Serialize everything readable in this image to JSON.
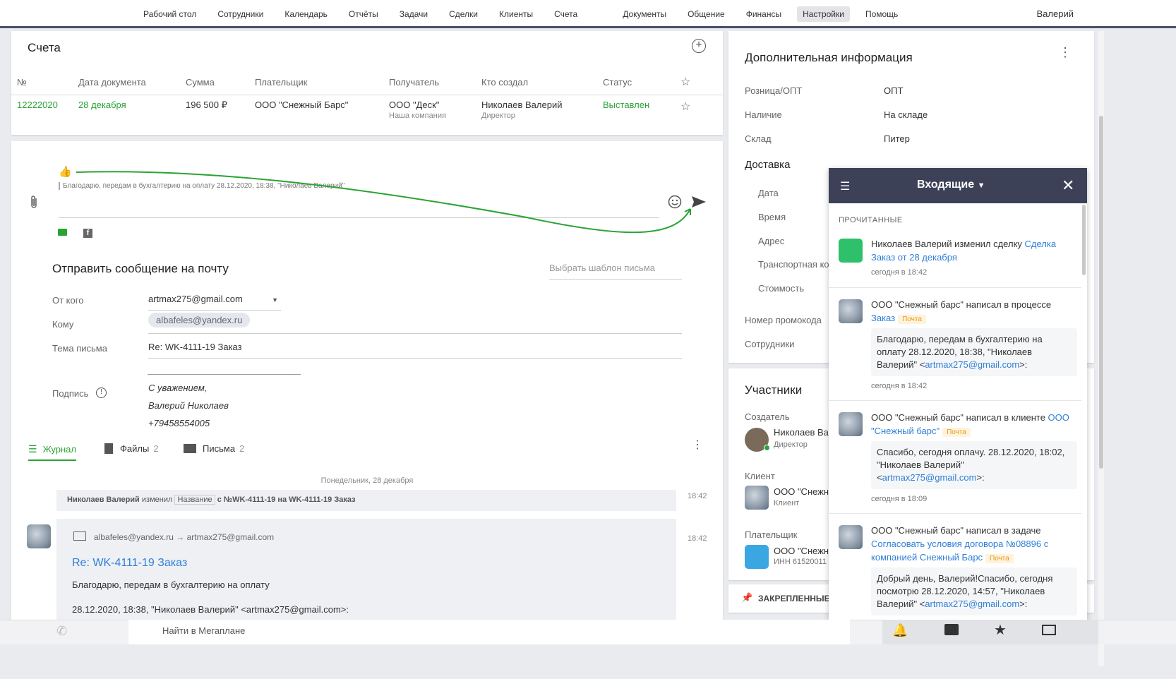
{
  "nav": {
    "items": [
      "Рабочий стол",
      "Сотрудники",
      "Календарь",
      "Отчёты",
      "Задачи",
      "Сделки",
      "Клиенты",
      "Счета",
      "Документы",
      "Общение",
      "Финансы",
      "Настройки",
      "Помощь"
    ],
    "active": "Настройки",
    "user": "Валерий"
  },
  "invoices": {
    "title": "Счета",
    "headers": [
      "№",
      "Дата документа",
      "Сумма",
      "Плательщик",
      "Получатель",
      "Кто создал",
      "Статус"
    ],
    "row": {
      "num": "12222020",
      "date": "28 декабря",
      "sum": "196 500 ₽",
      "payer": "ООО \"Снежный Барс\"",
      "recipient": "ООО \"Деск\"",
      "recipient_sub": "Наша компания",
      "creator": "Николаев Валерий",
      "creator_sub": "Директор",
      "status": "Выставлен"
    }
  },
  "composer": {
    "reply_quote": "Благодарю, передам в бухгалтерию на оплату  28.12.2020, 18:38, \"Николаев Валерий\"",
    "email_title": "Отправить сообщение на почту",
    "template_placeholder": "Выбрать шаблон письма",
    "from_label": "От кого",
    "from_value": "artmax275@gmail.com",
    "to_label": "Кому",
    "to_value": "albafeles@yandex.ru",
    "subject_label": "Тема письма",
    "subject_value": "Re: WK-4111-19 Заказ",
    "signature_label": "Подпись",
    "signature_lines": [
      "______________________________",
      "С уважением,",
      "Валерий Николаев",
      "+79458554005"
    ]
  },
  "tabs": [
    {
      "label": "Журнал",
      "count": ""
    },
    {
      "label": "Файлы",
      "count": "2"
    },
    {
      "label": "Письма",
      "count": "2"
    }
  ],
  "journal": {
    "date": "Понедельник, 28 декабря",
    "change": {
      "who": "Николаев Валерий",
      "verb": "изменил",
      "field": "Название",
      "text": "с №WK-4111-19 на WK-4111-19 Заказ",
      "time": "18:42"
    },
    "email": {
      "route": "albafeles@yandex.ru → artmax275@gmail.com",
      "time": "18:42",
      "subject": "Re: WK-4111-19 Заказ",
      "body1": "Благодарю, передам в бухгалтерию на оплату",
      "body2": "28.12.2020, 18:38, \"Николаев Валерий\" <artmax275@gmail.com>:"
    }
  },
  "info": {
    "title": "Дополнительная информация",
    "rows": [
      {
        "l": "Розница/ОПТ",
        "v": "ОПТ"
      },
      {
        "l": "Наличие",
        "v": "На складе"
      },
      {
        "l": "Склад",
        "v": "Питер"
      }
    ],
    "delivery": "Доставка",
    "delivery_rows": [
      "Дата",
      "Время",
      "Адрес",
      "Транспортная ко",
      "Стоимость"
    ],
    "promo": "Номер промокода",
    "staff": "Сотрудники"
  },
  "participants": {
    "title": "Участники",
    "creator_label": "Создатель",
    "creator_name": "Николаев Ва",
    "creator_role": "Директор",
    "client_label": "Клиент",
    "client_name": "ООО \"Снежн",
    "client_role": "Клиент",
    "payer_label": "Плательщик",
    "payer_name": "ООО \"Снежн",
    "payer_inn": "ИНН 61520011"
  },
  "pinned": "ЗАКРЕПЛЕННЫЕ",
  "inbox": {
    "title": "Входящие",
    "section": "ПРОЧИТАННЫЕ",
    "items": [
      {
        "who": "Николаев Валерий изменил сделку ",
        "link": "Сделка Заказ от 28 декабря",
        "time": "сегодня в 18:42"
      },
      {
        "who": "ООО \"Снежный барс\" написал в процессе ",
        "link": "Заказ",
        "badge": "Почта",
        "q1": "Благодарю, передам в бухгалтерию на оплату 28.12.2020, 18:38, \"Николаев Валерий\" <",
        "qlink": "artmax275@gmail.com",
        "q2": ">:",
        "time": "сегодня в 18:42"
      },
      {
        "who": "ООО \"Снежный барс\" написал в клиенте ",
        "link": "ООО \"Снежный барс\"",
        "badge": "Почта",
        "q1": "Спасибо, сегодня оплачу. 28.12.2020, 18:02, \"Николаев Валерий\" <",
        "qlink": "artmax275@gmail.com",
        "q2": ">:",
        "time": "сегодня в 18:09"
      },
      {
        "who": "ООО \"Снежный барс\" написал в задаче ",
        "link": "Согласовать условия договора №08896 с компанией Снежный Барс",
        "badge": "Почта",
        "q1": "Добрый день, Валерий!Спасибо, сегодня посмотрю 28.12.2020, 14:57, \"Николаев Валерий\" <",
        "qlink": "artmax275@gmail.com",
        "q2": ">:"
      }
    ]
  },
  "bottom": {
    "search": "Найти в Мегаплане"
  }
}
